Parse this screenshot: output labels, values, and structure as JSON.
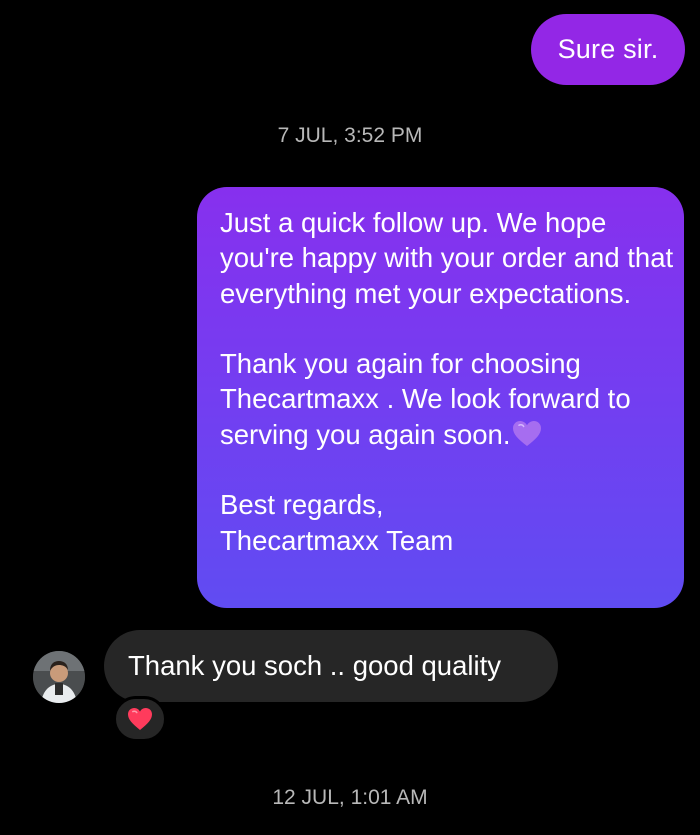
{
  "messages": {
    "outgoing_short": {
      "text": "Sure sir."
    },
    "timestamp_1": "7 JUL, 3:52 PM",
    "outgoing_long": {
      "line1": "Just a quick follow up. We hope you're happy with your order and that everything met your expectations.",
      "line2": "Thank you again for choosing Thecartmaxx . We look forward to serving you again soon.",
      "line2_emoji": "purple-heart-emoji",
      "line3": "Best regards,",
      "line4": "Thecartmaxx Team"
    },
    "incoming": {
      "text": "Thank you soch .. good quality",
      "reaction": "red-heart-emoji"
    },
    "timestamp_2": "12 JUL, 1:01 AM"
  },
  "colors": {
    "background": "#000000",
    "outgoing_short_bubble": "#9327e6",
    "outgoing_long_gradient_top": "#8730ee",
    "outgoing_long_gradient_bottom": "#604cf2",
    "incoming_bubble": "#262626",
    "timestamp_text": "#b8b8b8",
    "reaction_heart": "#ff3b5c",
    "purple_heart": "#a66df0"
  }
}
